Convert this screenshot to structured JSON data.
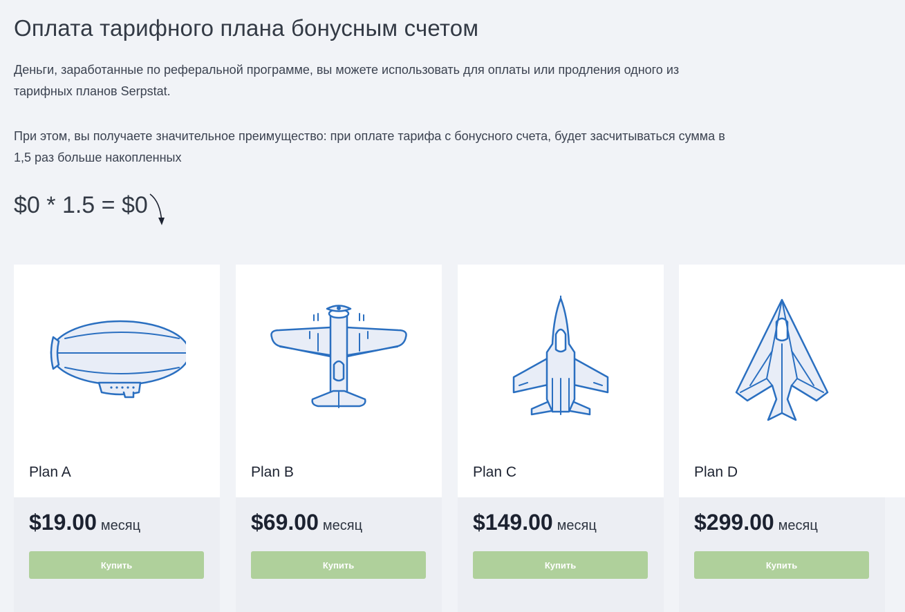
{
  "page": {
    "title": "Оплата тарифного плана бонусным счетом",
    "paragraph1": "Деньги, заработанные по реферальной программе, вы можете использовать для оплаты или продления одного из тарифных планов Serpstat.",
    "paragraph2": "При этом, вы получаете значительное преимущество: при оплате тарифа с бонусного счета, будет засчитываться сумма в 1,5 раз больше накопленных",
    "formula": "$0 * 1.5 = $0"
  },
  "plans": [
    {
      "name": "Plan A",
      "price": "$19.00",
      "period": "месяц",
      "button": "Купить",
      "icon": "airship-icon"
    },
    {
      "name": "Plan B",
      "price": "$69.00",
      "period": "месяц",
      "button": "Купить",
      "icon": "propeller-plane-icon"
    },
    {
      "name": "Plan C",
      "price": "$149.00",
      "period": "месяц",
      "button": "Купить",
      "icon": "fighter-jet-icon"
    },
    {
      "name": "Plan D",
      "price": "$299.00",
      "period": "месяц",
      "button": "Купить",
      "icon": "stealth-jet-icon"
    }
  ],
  "colors": {
    "background": "#f1f3f7",
    "card": "#ffffff",
    "card_bottom": "#eceef3",
    "button": "#afd09b",
    "icon_stroke": "#2a6fc0"
  }
}
